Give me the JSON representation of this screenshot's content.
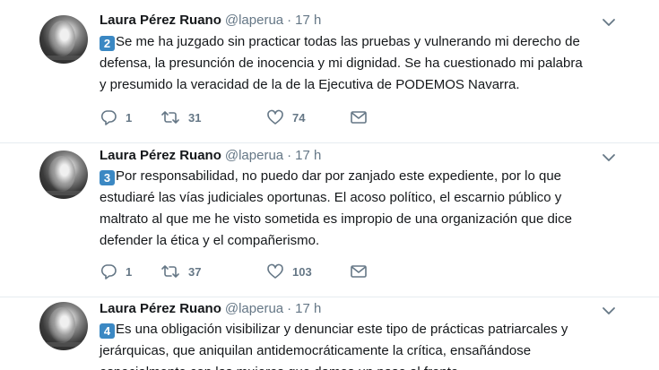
{
  "tweets": [
    {
      "name": "Laura Pérez Ruano",
      "handle": "@laperua",
      "separator": "·",
      "time": "17 h",
      "number_emoji": "2",
      "lines": [
        "Se me ha juzgado sin practicar todas las pruebas y vulnerando mi derecho de",
        "defensa, la presunción de inocencia y mi dignidad. Se ha cuestionado mi palabra",
        "y presumido la veracidad de la de la Ejecutiva de PODEMOS Navarra."
      ],
      "replies": "1",
      "retweets": "31",
      "likes": "74"
    },
    {
      "name": "Laura Pérez Ruano",
      "handle": "@laperua",
      "separator": "·",
      "time": "17 h",
      "number_emoji": "3",
      "lines": [
        "Por responsabilidad, no puedo dar por zanjado este expediente, por lo que",
        "estudiaré las vías judiciales oportunas. El acoso político, el escarnio público y",
        "maltrato al que me he visto sometida es impropio de una organización que dice",
        "defender la ética y el compañerismo."
      ],
      "replies": "1",
      "retweets": "37",
      "likes": "103"
    },
    {
      "name": "Laura Pérez Ruano",
      "handle": "@laperua",
      "separator": "·",
      "time": "17 h",
      "number_emoji": "4",
      "lines": [
        "Es una obligación visibilizar y denunciar este tipo de prácticas patriarcales y",
        "jerárquicas, que aniquilan antidemocráticamente la crítica, ensañándose",
        "especialmente con las mujeres que damos un paso al frente."
      ]
    }
  ],
  "colors": {
    "text": "#14171a",
    "secondary": "#657786",
    "keycap": "#3b88c3",
    "divider": "#e6ecf0"
  },
  "icons": [
    "reply-icon",
    "retweet-icon",
    "like-icon",
    "message-icon",
    "chevron-down-icon"
  ]
}
